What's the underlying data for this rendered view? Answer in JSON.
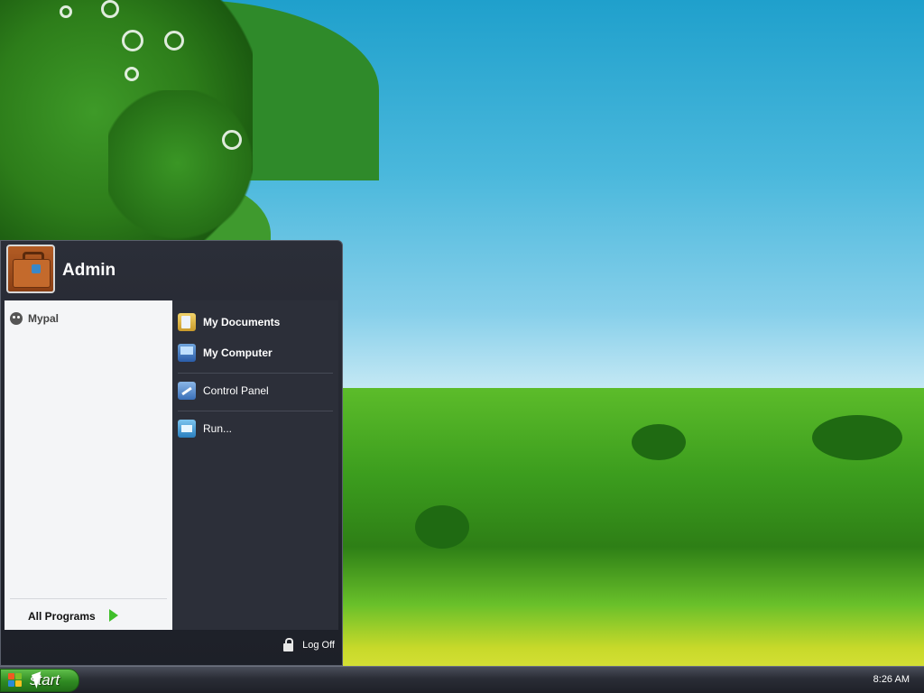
{
  "start_menu": {
    "user": {
      "name": "Admin",
      "avatar": "briefcase-avatar"
    },
    "pinned": [
      {
        "label": "Mypal",
        "icon": "mypal-icon"
      }
    ],
    "all_programs_label": "All Programs",
    "places": [
      {
        "label": "My Documents",
        "icon": "my-documents-icon",
        "bold": true
      },
      {
        "label": "My Computer",
        "icon": "my-computer-icon",
        "bold": true
      },
      {
        "label": "Control Panel",
        "icon": "control-panel-icon",
        "bold": false
      },
      {
        "label": "Run...",
        "icon": "run-icon",
        "bold": false
      }
    ],
    "logoff_label": "Log Off"
  },
  "taskbar": {
    "start_label": "start",
    "clock": "8:26 AM"
  },
  "colors": {
    "menu_dark": "#2c2f39",
    "menu_light": "#f4f5f7",
    "start_green": "#2f8a22",
    "taskbar": "#2a2d36"
  }
}
